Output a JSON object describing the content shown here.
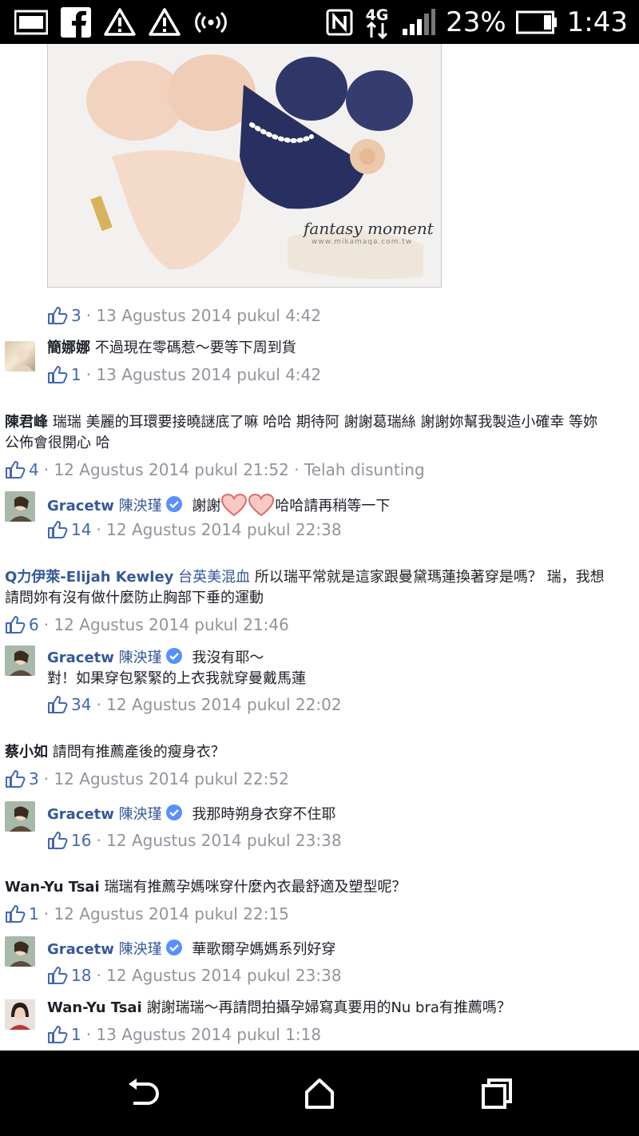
{
  "status_bar": {
    "battery_percent": "23%",
    "time": "1:43",
    "network": "4G"
  },
  "post_image": {
    "caption": "fantasy moment",
    "url": "www.mikamaqa.com.tw",
    "likes": "3",
    "timestamp": "· 13 Agustus 2014 pukul 4:42"
  },
  "comments": [
    {
      "author": "簡娜娜",
      "text": "不過現在零碼惹～要等下周到貨",
      "likes": "1",
      "timestamp": "· 13 Agustus 2014 pukul 4:42"
    },
    {
      "author": "陳君峰",
      "text_line1": "瑞瑞 美麗的耳環要接曉謎底了嘛 哈哈 期待阿 謝謝葛瑞絲 謝謝妳幫我製造小確幸 等妳",
      "text_line2": "公佈會很開心 哈",
      "likes": "4",
      "timestamp": "· 12 Agustus 2014 pukul 21:52 · Telah disunting",
      "reply": {
        "author": "Gracetw",
        "author_zh": "陳泱瑾",
        "text_before": "謝謝",
        "text_after": "哈哈請再稍等一下",
        "likes": "14",
        "timestamp": "· 12 Agustus 2014 pukul 22:38"
      }
    },
    {
      "author": "Q力伊萊-Elijah Kewley",
      "author_zh": "台英美混血",
      "text_line1": "所以瑞平常就是這家跟曼黛瑪蓮換著穿是嗎？ 瑞，我想",
      "text_line2": "請問妳有沒有做什麼防止胸部下垂的運動",
      "likes": "6",
      "timestamp": "· 12 Agustus 2014 pukul 21:46",
      "reply": {
        "author": "Gracetw",
        "author_zh": "陳泱瑾",
        "text_line1": "我沒有耶～",
        "text_line2": "對！如果穿包緊緊的上衣我就穿曼戴馬蓮",
        "likes": "34",
        "timestamp": "· 12 Agustus 2014 pukul 22:02"
      }
    },
    {
      "author": "蔡小如",
      "text": "請問有推薦產後的瘦身衣？",
      "likes": "3",
      "timestamp": "· 12 Agustus 2014 pukul 22:52",
      "reply": {
        "author": "Gracetw",
        "author_zh": "陳泱瑾",
        "text": "我那時朔身衣穿不住耶",
        "likes": "16",
        "timestamp": "· 12 Agustus 2014 pukul 23:38"
      }
    },
    {
      "author": "Wan-Yu Tsai",
      "text": "瑞瑞有推薦孕媽咪穿什麼內衣最舒適及塑型呢？",
      "likes": "1",
      "timestamp": "· 12 Agustus 2014 pukul 22:15",
      "replies": [
        {
          "author": "Gracetw",
          "author_zh": "陳泱瑾",
          "text": "華歌爾孕媽媽系列好穿",
          "likes": "18",
          "timestamp": "· 12 Agustus 2014 pukul 23:38"
        },
        {
          "author": "Wan-Yu Tsai",
          "text": "謝謝瑞瑞～再請問拍攝孕婦寫真要用的Nu bra有推薦嗎？",
          "likes": "1",
          "timestamp": "· 13 Agustus 2014 pukul 1:18"
        }
      ]
    }
  ],
  "colors": {
    "link_blue": "#365899",
    "like_blue": "#4267b2",
    "meta_gray": "#90949c",
    "verified_blue": "#5890ff"
  }
}
